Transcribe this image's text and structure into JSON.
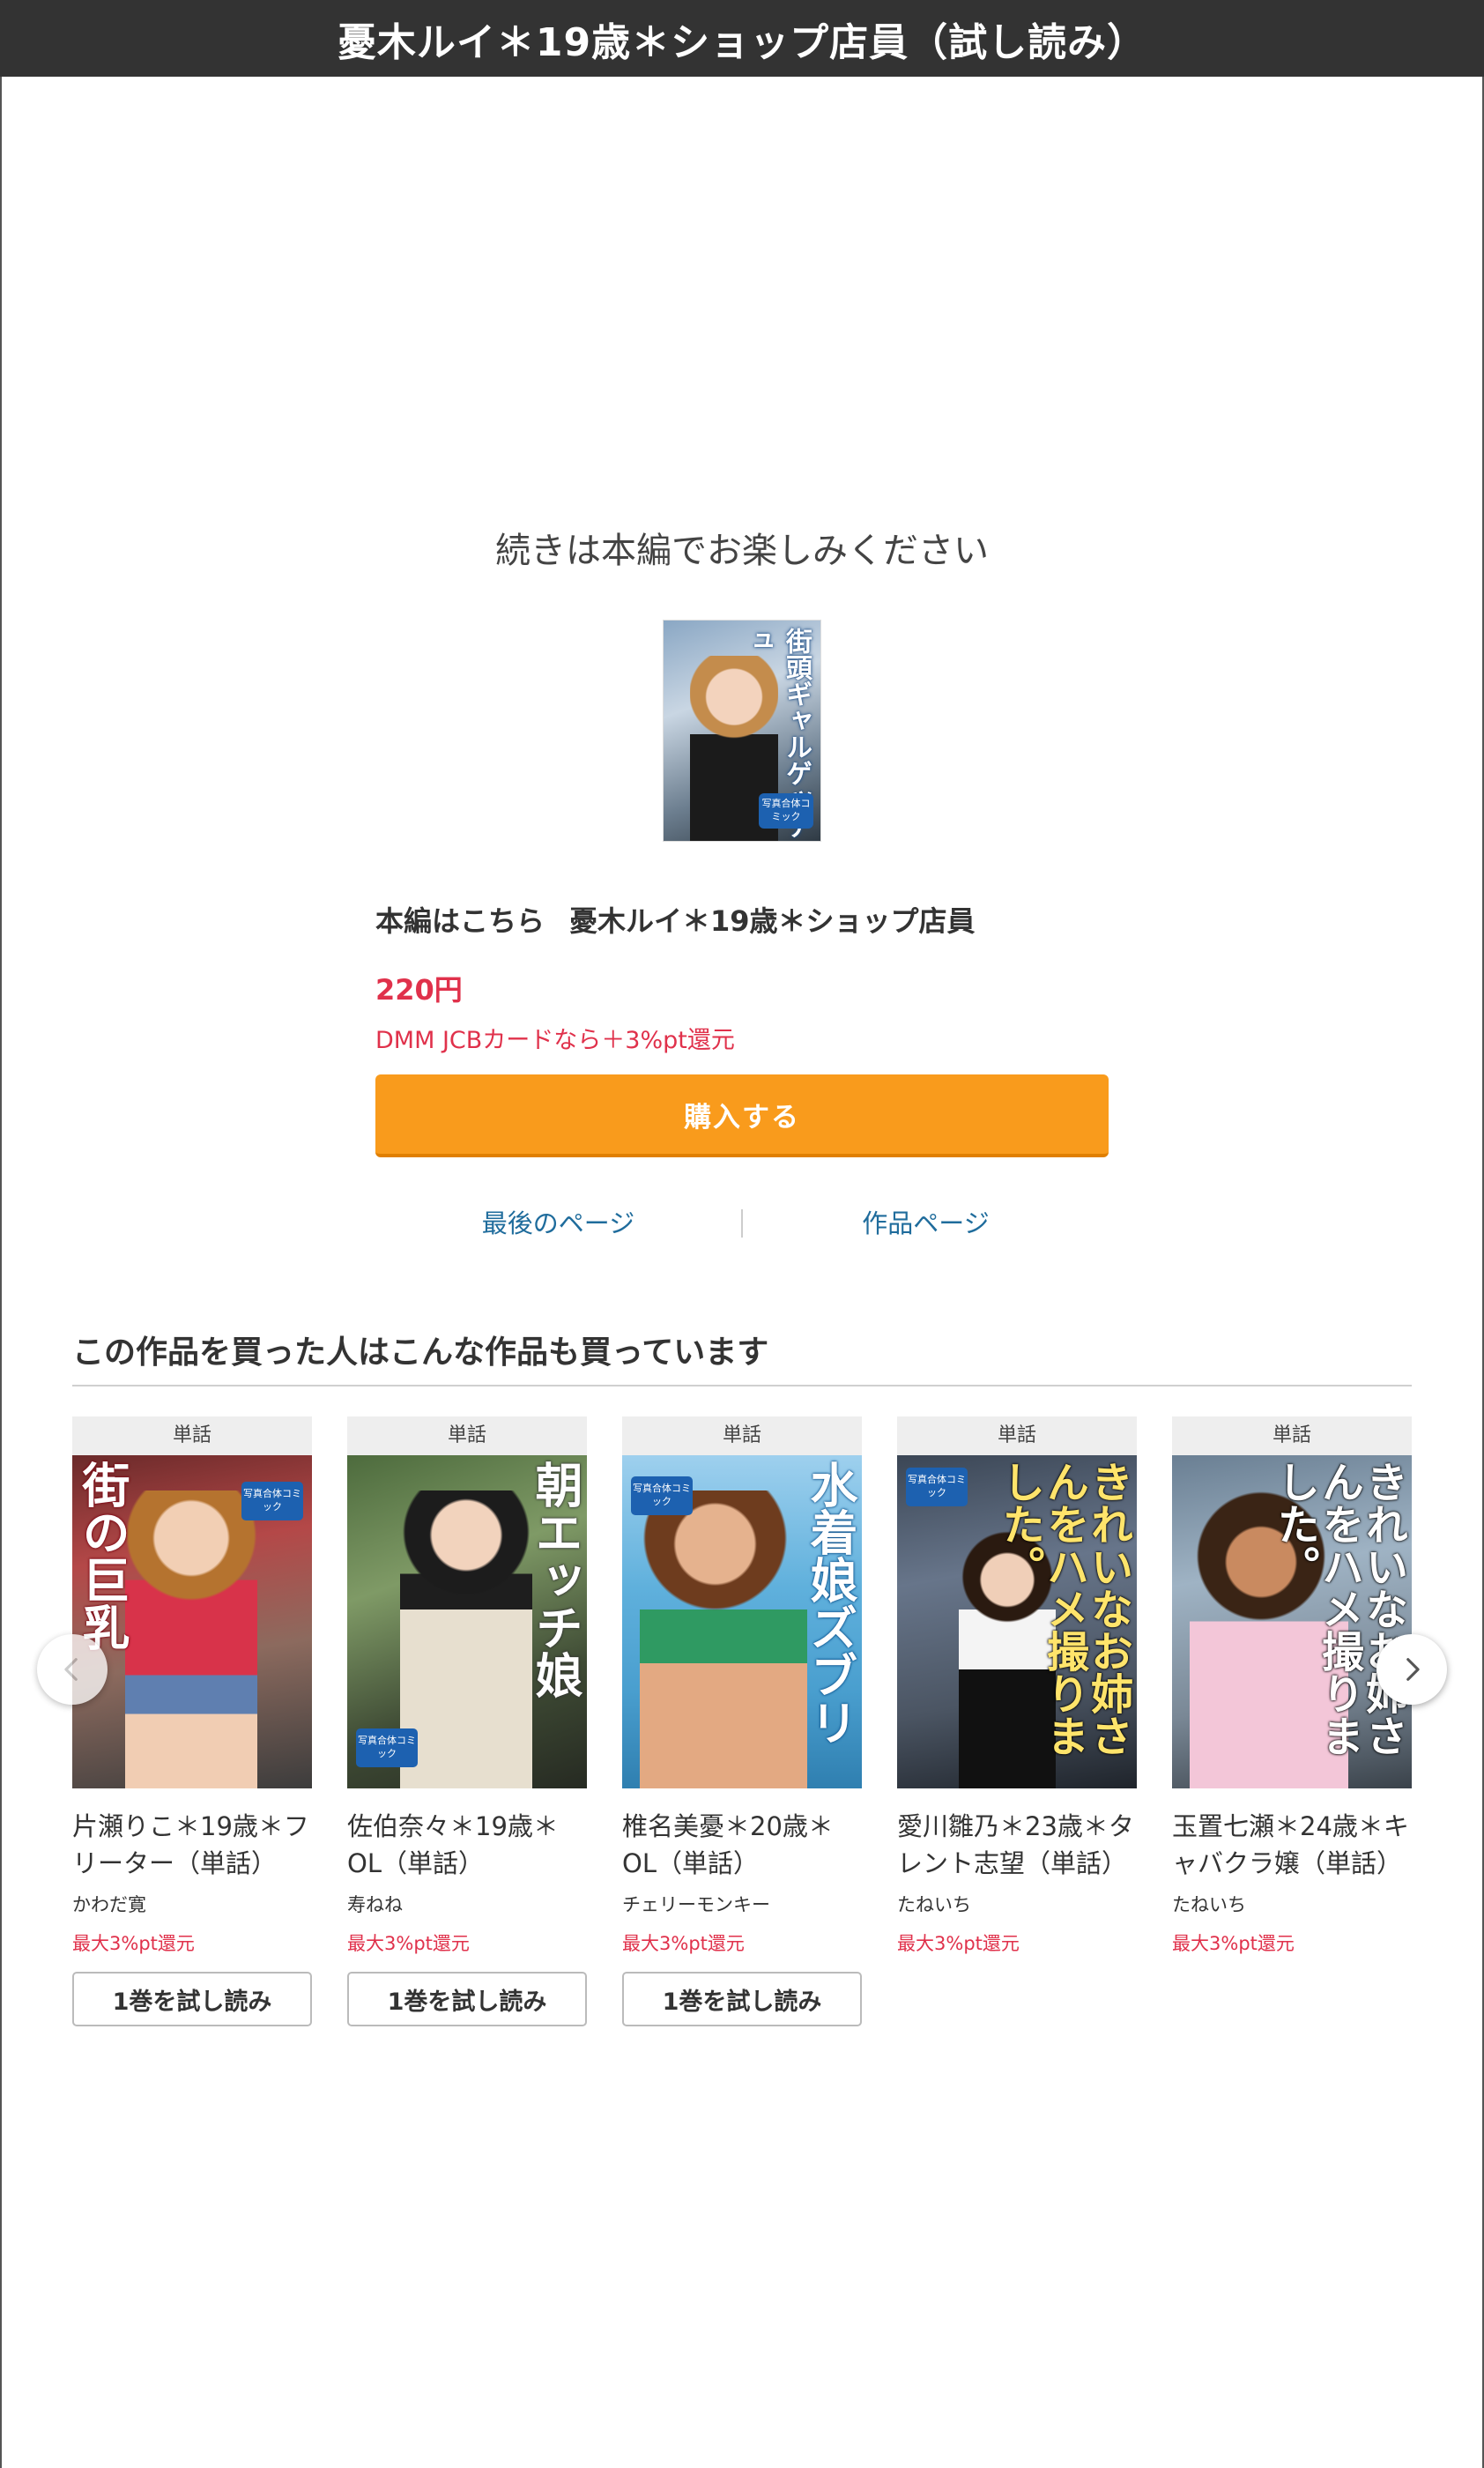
{
  "header": {
    "title": "憂木ルイ＊19歳＊ショップ店員（試し読み）"
  },
  "continue_message": "続きは本編でお楽しみください",
  "main": {
    "cover": {
      "title_text": "街頭ギャルゲッチュ",
      "badge_text": "写真合体コミック"
    },
    "title_prefix": "本編はこちら",
    "title": "憂木ルイ＊19歳＊ショップ店員",
    "price": "220円",
    "point_note": "DMM JCBカードなら＋3%pt還元",
    "buy_label": "購入する"
  },
  "links": {
    "last_page": "最後のページ",
    "product_page": "作品ページ"
  },
  "recommendations": {
    "heading": "この作品を買った人はこんな作品も買っています",
    "items": [
      {
        "tag": "単話",
        "cover_text": "街の巨乳",
        "name": "片瀬りこ＊19歳＊フリーター（単話）",
        "author": "かわだ寛",
        "point": "最大3%pt還元",
        "trial_label": "1巻を試し読み"
      },
      {
        "tag": "単話",
        "cover_text": "朝エッチ娘",
        "name": "佐伯奈々＊19歳＊OL（単話）",
        "author": "寿ねね",
        "point": "最大3%pt還元",
        "trial_label": "1巻を試し読み"
      },
      {
        "tag": "単話",
        "cover_text": "水着娘ズブリ",
        "name": "椎名美憂＊20歳＊OL（単話）",
        "author": "チェリーモンキー",
        "point": "最大3%pt還元",
        "trial_label": "1巻を試し読み"
      },
      {
        "tag": "単話",
        "cover_text": "きれいなお姉さんをハメ撮りました。",
        "name": "愛川雛乃＊23歳＊タレント志望（単話）",
        "author": "たねいち",
        "point": "最大3%pt還元",
        "trial_label": ""
      },
      {
        "tag": "単話",
        "cover_text": "きれいなお姉さんをハメ撮りました。",
        "name": "玉置七瀬＊24歳＊キャバクラ嬢（単話）",
        "author": "たねいち",
        "point": "最大3%pt還元",
        "trial_label": ""
      }
    ]
  },
  "icons": {
    "prev": "chevron-left-icon",
    "next": "chevron-right-icon"
  },
  "colors": {
    "buy_button": "#f99b1c",
    "price": "#e0314b",
    "link": "#1f6c9c",
    "header_bg": "#333333"
  }
}
